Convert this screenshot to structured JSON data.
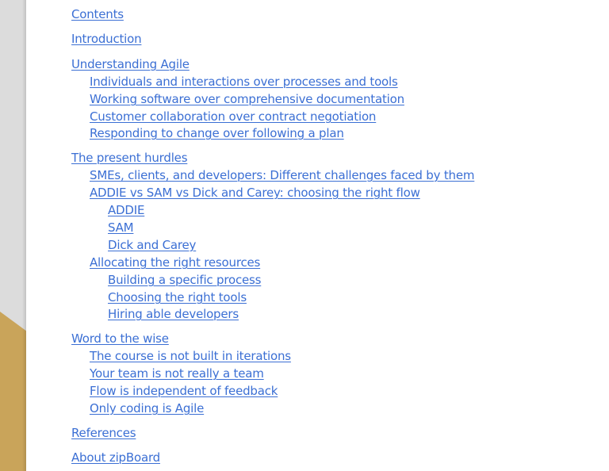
{
  "document": {
    "link_color": "#3b6fd4",
    "backdrop_color": "#dcdcdc",
    "accent_color": "#c9a45a",
    "toc": [
      {
        "label": "Contents",
        "level": 1
      },
      {
        "label": "Introduction",
        "level": 1
      },
      {
        "label": "Understanding Agile",
        "level": 1
      },
      {
        "label": "Individuals and interactions over processes and tools",
        "level": 2
      },
      {
        "label": "Working software over comprehensive documentation",
        "level": 2
      },
      {
        "label": "Customer collaboration over contract negotiation",
        "level": 2
      },
      {
        "label": "Responding to change over following a plan",
        "level": 2
      },
      {
        "label": "The present hurdles",
        "level": 1
      },
      {
        "label": "SMEs, clients, and developers: Different challenges faced by them",
        "level": 2
      },
      {
        "label": "ADDIE vs SAM vs Dick and Carey: choosing the right flow",
        "level": 2
      },
      {
        "label": "ADDIE",
        "level": 3
      },
      {
        "label": "SAM",
        "level": 3
      },
      {
        "label": "Dick and Carey",
        "level": 3
      },
      {
        "label": "Allocating the right resources",
        "level": 2
      },
      {
        "label": "Building a specific process",
        "level": 3
      },
      {
        "label": "Choosing the right tools",
        "level": 3
      },
      {
        "label": "Hiring able developers",
        "level": 3
      },
      {
        "label": "Word to the wise",
        "level": 1
      },
      {
        "label": "The course is not built in iterations",
        "level": 2
      },
      {
        "label": "Your team is not really a team",
        "level": 2
      },
      {
        "label": "Flow is independent of feedback",
        "level": 2
      },
      {
        "label": "Only coding is Agile",
        "level": 2
      },
      {
        "label": "References",
        "level": 1
      },
      {
        "label": "About zipBoard",
        "level": 1
      }
    ]
  }
}
